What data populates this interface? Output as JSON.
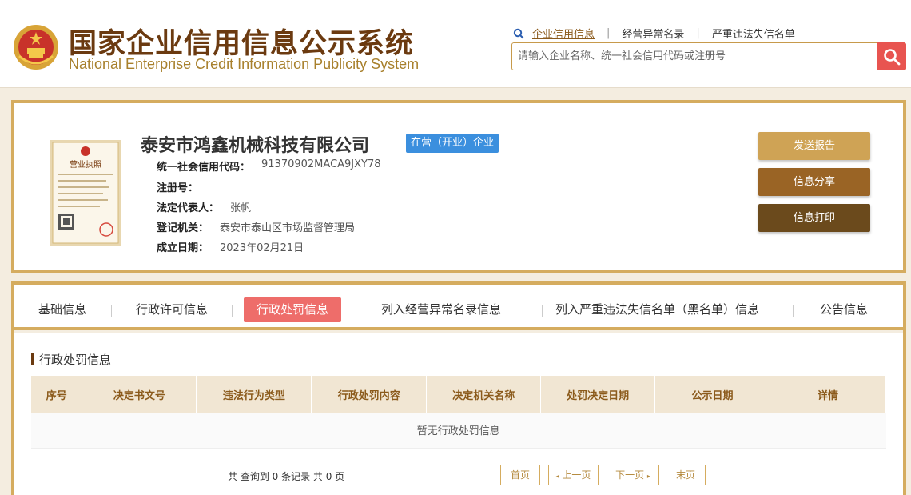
{
  "header": {
    "title_cn": "国家企业信用信息公示系统",
    "title_en": "National Enterprise Credit Information Publicity System",
    "links": [
      {
        "label": "企业信用信息"
      },
      {
        "label": "经营异常名录"
      },
      {
        "label": "严重违法失信名单"
      }
    ],
    "search_placeholder": "请输入企业名称、统一社会信用代码或注册号"
  },
  "company": {
    "name": "泰安市鸿鑫机械科技有限公司",
    "status": "在营（开业）企业",
    "license_title": "营业执照",
    "fields": [
      {
        "label": "统一社会信用代码：",
        "value": "91370902MACA9JXY78"
      },
      {
        "label": "注册号：",
        "value": ""
      },
      {
        "label": "法定代表人：",
        "value": "张帆"
      },
      {
        "label": "登记机关：",
        "value": "泰安市泰山区市场监督管理局"
      },
      {
        "label": "成立日期：",
        "value": "2023年02月21日"
      }
    ],
    "buttons": [
      {
        "label": "发送报告",
        "color": "#cfa355"
      },
      {
        "label": "信息分享",
        "color": "#9a6425"
      },
      {
        "label": "信息打印",
        "color": "#6b4a1c"
      }
    ]
  },
  "tabs": [
    {
      "label": "基础信息"
    },
    {
      "label": "行政许可信息"
    },
    {
      "label": "行政处罚信息"
    },
    {
      "label": "列入经营异常名录信息"
    },
    {
      "label": "列入严重违法失信名单（黑名单）信息"
    },
    {
      "label": "公告信息"
    }
  ],
  "section": {
    "title": "行政处罚信息",
    "columns": [
      "序号",
      "决定书文号",
      "违法行为类型",
      "行政处罚内容",
      "决定机关名称",
      "处罚决定日期",
      "公示日期",
      "详情"
    ],
    "empty_text": "暂无行政处罚信息"
  },
  "pager": {
    "info": "共 查询到 0 条记录 共 0 页",
    "first": "首页",
    "prev": "上一页",
    "next": "下一页",
    "last": "末页"
  },
  "colors": {
    "accent_gold": "#d5ac5f",
    "active_tab": "#ee6d6a",
    "status_blue": "#3b8fde",
    "search_red": "#e85450"
  }
}
